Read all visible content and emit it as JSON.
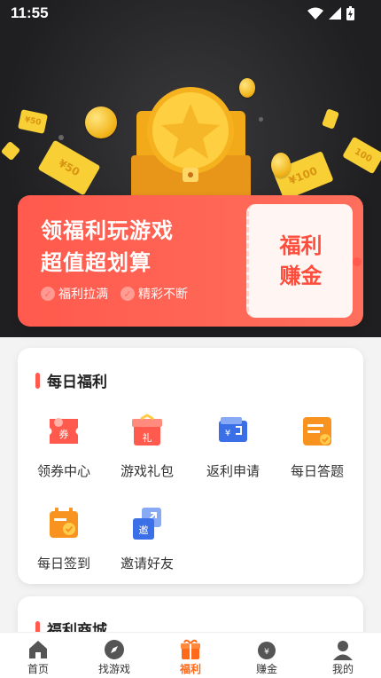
{
  "status_bar": {
    "time": "11:55"
  },
  "hero": {
    "ticket_labels": [
      "¥50",
      "¥50",
      "¥100",
      "100"
    ]
  },
  "promo": {
    "title_line1": "领福利玩游戏",
    "title_line2": "超值超划算",
    "tag1": "福利拉满",
    "tag2": "精彩不断",
    "card_line1": "福利",
    "card_line2": "赚金"
  },
  "daily": {
    "title": "每日福利",
    "items": [
      {
        "label": "领券中心",
        "icon": "coupon-icon",
        "glyph": "券"
      },
      {
        "label": "游戏礼包",
        "icon": "gift-icon",
        "glyph": "礼"
      },
      {
        "label": "返利申请",
        "icon": "wallet-icon",
        "glyph": "¥"
      },
      {
        "label": "每日答题",
        "icon": "quiz-icon",
        "glyph": ""
      },
      {
        "label": "每日签到",
        "icon": "calendar-check-icon",
        "glyph": ""
      },
      {
        "label": "邀请好友",
        "icon": "invite-icon",
        "glyph": "邀"
      }
    ]
  },
  "mall": {
    "title": "福利商城"
  },
  "tabs": [
    {
      "label": "首页",
      "icon": "home-icon"
    },
    {
      "label": "找游戏",
      "icon": "compass-icon"
    },
    {
      "label": "福利",
      "icon": "gift-icon"
    },
    {
      "label": "赚金",
      "icon": "money-bag-icon"
    },
    {
      "label": "我的",
      "icon": "user-icon"
    }
  ],
  "colors": {
    "accent": "#ff5a4d",
    "active_tab": "#ff6a1a",
    "hero_bg": "#1f1f21"
  }
}
